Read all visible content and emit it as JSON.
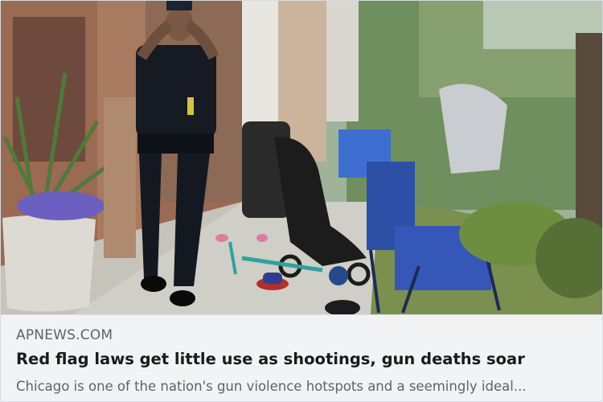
{
  "link_preview": {
    "image_alt": "Police officer covering face near abandoned strollers and chairs on sidewalk",
    "source": "APNEWS.COM",
    "headline": "Red flag laws get little use as shootings, gun deaths soar",
    "description": "Chicago is one of the nation's gun violence hotspots and a seemingly ideal..."
  }
}
